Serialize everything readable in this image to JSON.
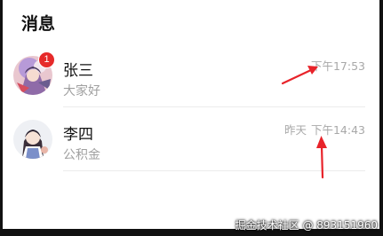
{
  "header": {
    "title": "消息"
  },
  "conversations": [
    {
      "name": "张三",
      "snippet": "大家好",
      "date": "",
      "time": "下午17:53",
      "unread": "1"
    },
    {
      "name": "李四",
      "snippet": "公积金",
      "date": "昨天",
      "time": "下午14:43",
      "unread": ""
    }
  ],
  "watermark": "掘金技术社区 @ 893151960",
  "colors": {
    "badge": "#e62a2a",
    "annotation_arrow": "#e8232a",
    "time_text": "#a8a8a8"
  }
}
